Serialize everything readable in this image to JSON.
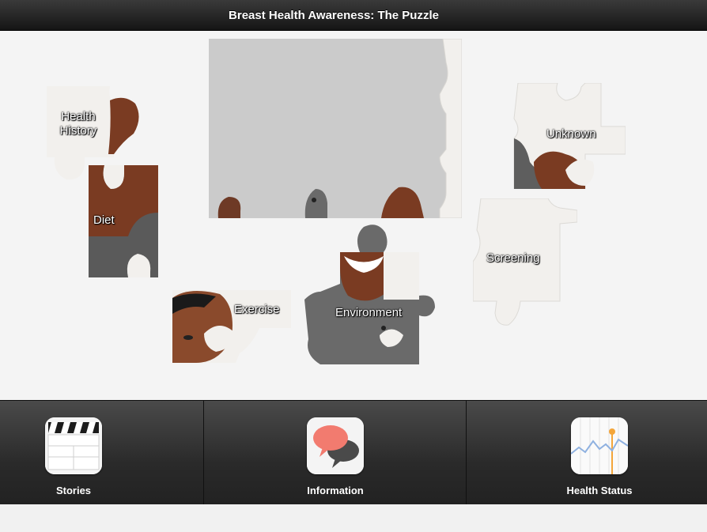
{
  "window": {
    "title": "Breast Health Awareness: The Puzzle"
  },
  "pieces": [
    {
      "id": "health-history",
      "label": "Health History"
    },
    {
      "id": "diet",
      "label": "Diet"
    },
    {
      "id": "exercise",
      "label": "Exercise"
    },
    {
      "id": "environment",
      "label": "Environment"
    },
    {
      "id": "unknown",
      "label": "Unknown"
    },
    {
      "id": "screening",
      "label": "Screening"
    }
  ],
  "tabs": [
    {
      "label": "Stories",
      "icon": "clapperboard-icon"
    },
    {
      "label": "Information",
      "icon": "speech-bubbles-icon"
    },
    {
      "label": "Health Status",
      "icon": "line-chart-icon"
    }
  ],
  "colors": {
    "titlebar": "#1e1e1e",
    "puzzle_frame": "#cbcbcb",
    "piece_white": "#f2f0ed",
    "skin": "#7a3b22",
    "houndstooth": "#6a6a6a"
  }
}
